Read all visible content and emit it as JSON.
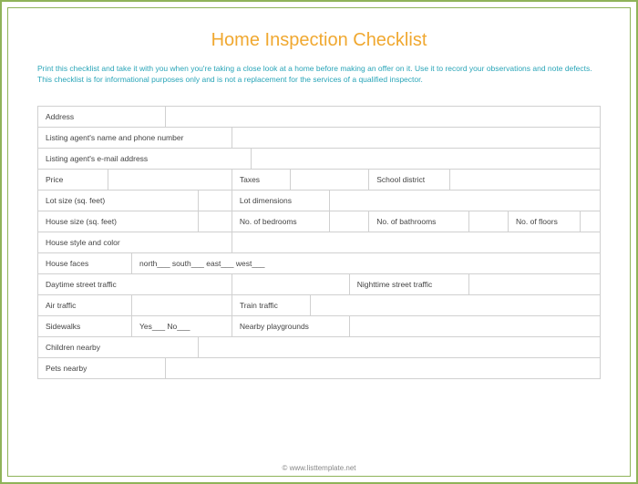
{
  "title": "Home Inspection Checklist",
  "intro": "Print this checklist and take it with you when you're taking a close look at a home before making an offer on it. Use it to record your observations and note defects. This checklist is for informational purposes only and is not a replacement for the services of a qualified inspector.",
  "labels": {
    "address": "Address",
    "listing_agent_name_phone": "Listing agent's name and phone number",
    "listing_agent_email": "Listing agent's e-mail address",
    "price": "Price",
    "taxes": "Taxes",
    "school_district": "School district",
    "lot_size": "Lot size (sq. feet)",
    "lot_dimensions": "Lot dimensions",
    "house_size": "House size (sq. feet)",
    "no_bedrooms": "No. of bedrooms",
    "no_bathrooms": "No. of bathrooms",
    "no_floors": "No. of floors",
    "house_style_color": "House style and color",
    "house_faces": "House faces",
    "house_faces_options": "north___   south___   east___   west___",
    "daytime_traffic": "Daytime street traffic",
    "nighttime_traffic": "Nighttime street traffic",
    "air_traffic": "Air traffic",
    "train_traffic": "Train traffic",
    "sidewalks": "Sidewalks",
    "sidewalks_options": "Yes___   No___",
    "nearby_playgrounds": "Nearby playgrounds",
    "children_nearby": "Children nearby",
    "pets_nearby": "Pets nearby"
  },
  "footer": "© www.listtemplate.net"
}
